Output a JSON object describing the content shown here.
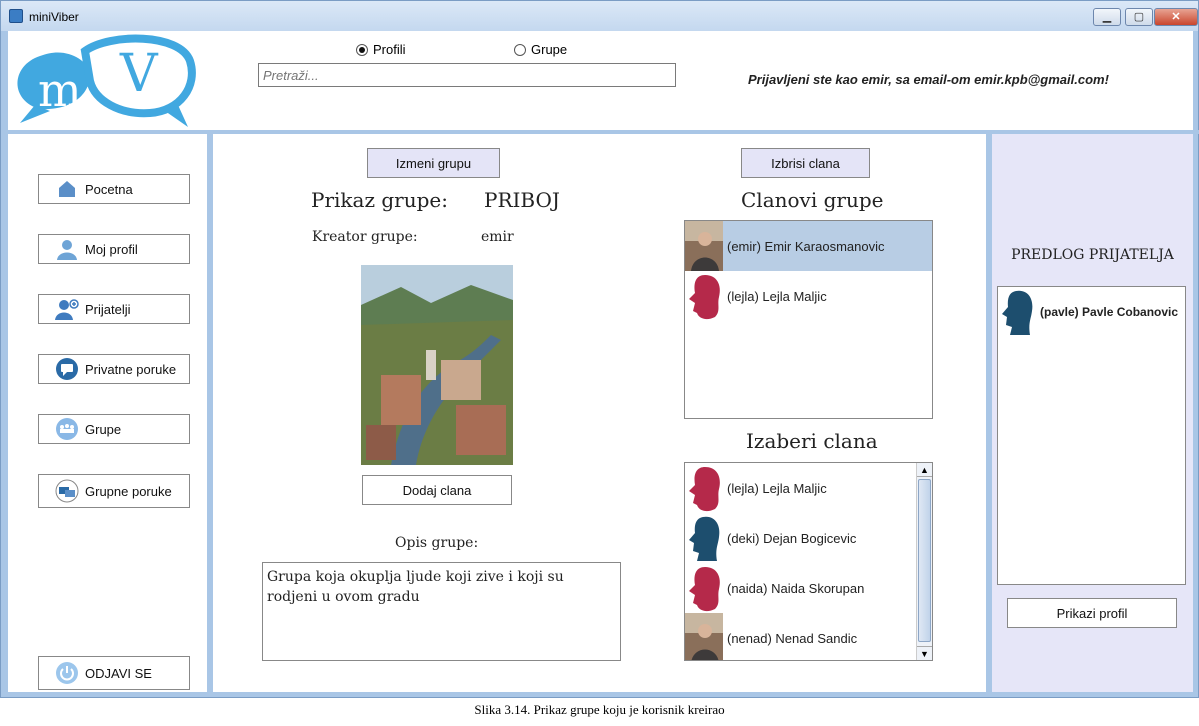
{
  "window": {
    "title": "miniViber"
  },
  "header": {
    "radio_profiles": "Profili",
    "radio_groups": "Grupe",
    "search_placeholder": "Pretraži...",
    "login_info": "Prijavljeni ste kao emir, sa email-om emir.kpb@gmail.com!"
  },
  "sidebar": {
    "items": [
      {
        "label": "Pocetna"
      },
      {
        "label": "Moj profil"
      },
      {
        "label": "Prijatelji"
      },
      {
        "label": "Privatne poruke"
      },
      {
        "label": "Grupe"
      },
      {
        "label": "Grupne poruke"
      }
    ],
    "logout": "ODJAVI SE"
  },
  "group": {
    "edit_button": "Izmeni grupu",
    "title_label": "Prikaz grupe:",
    "name": "PRIBOJ",
    "creator_label": "Kreator grupe:",
    "creator": "emir",
    "add_member_button": "Dodaj clana",
    "description_label": "Opis grupe:",
    "description": "Grupa koja okuplja ljude koji zive i koji su rodjeni u ovom gradu"
  },
  "members": {
    "remove_button": "Izbrisi clana",
    "title": "Clanovi grupe",
    "list": [
      {
        "label": "(emir) Emir Karaosmanovic",
        "avatar": "photo",
        "selected": true
      },
      {
        "label": "(lejla) Lejla Maljic",
        "avatar": "female",
        "selected": false
      }
    ]
  },
  "choose": {
    "title": "Izaberi clana",
    "list": [
      {
        "label": "(lejla) Lejla Maljic",
        "avatar": "female"
      },
      {
        "label": "(deki) Dejan Bogicevic",
        "avatar": "male"
      },
      {
        "label": "(naida) Naida Skorupan",
        "avatar": "female"
      },
      {
        "label": "(nenad) Nenad Sandic",
        "avatar": "photo"
      }
    ]
  },
  "suggestions": {
    "title": "PREDLOG PRIJATELJA",
    "list": [
      {
        "label": "(pavle) Pavle Cobanovic",
        "avatar": "male"
      }
    ],
    "show_profile_button": "Prikazi profil"
  },
  "caption": "Slika 3.14. Prikaz grupe koju je korisnik kreirao",
  "colors": {
    "accent": "#a9c6e6",
    "female": "#b5294a",
    "male": "#1d4e6e",
    "selection": "#b8cde4"
  }
}
